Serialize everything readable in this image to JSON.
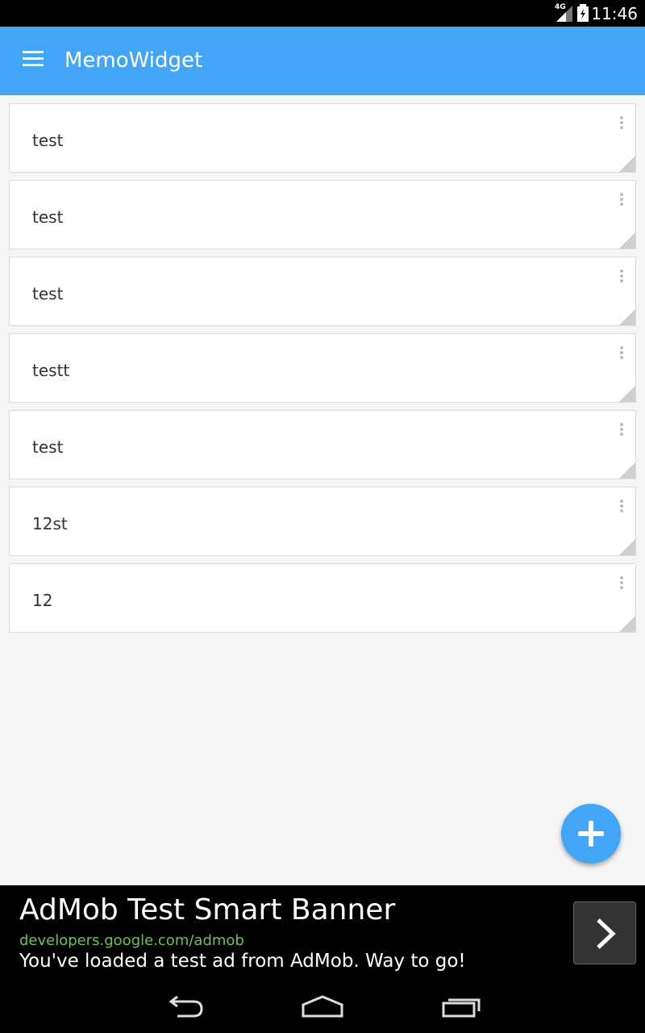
{
  "status_bar": {
    "network_type": "4G",
    "time": "11:46"
  },
  "app_bar": {
    "title": "MemoWidget",
    "menu_icon": "hamburger-menu-icon"
  },
  "memos": [
    {
      "text": "test"
    },
    {
      "text": "test"
    },
    {
      "text": "test"
    },
    {
      "text": "testt"
    },
    {
      "text": "test"
    },
    {
      "text": "12st"
    },
    {
      "text": "12"
    }
  ],
  "fab": {
    "icon": "plus-icon",
    "color": "#42a5f5"
  },
  "ad": {
    "title": "AdMob Test Smart Banner",
    "url": "developers.google.com/admob",
    "description": "You've loaded a test ad from AdMob. Way to go!",
    "arrow_icon": "chevron-right-icon"
  },
  "nav_bar": {
    "back_icon": "back-icon",
    "home_icon": "home-icon",
    "recents_icon": "recent-apps-icon"
  },
  "colors": {
    "accent": "#42a5f5",
    "background": "#f5f5f5",
    "ad_url": "#6fbf5a"
  }
}
